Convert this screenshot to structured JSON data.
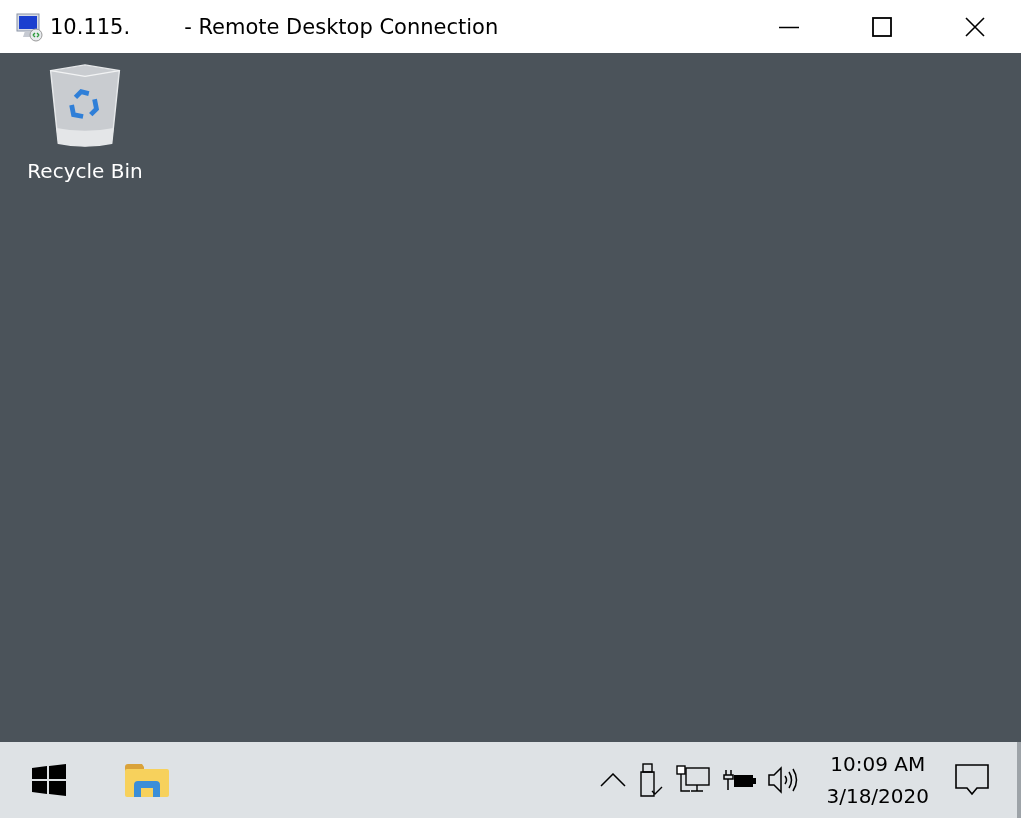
{
  "window": {
    "title_host": "10.115.",
    "title_app": "- Remote Desktop Connection"
  },
  "desktop": {
    "icons": [
      {
        "label": "Recycle Bin"
      }
    ]
  },
  "taskbar": {
    "clock": {
      "time": "10:09 AM",
      "date": "3/18/2020"
    }
  }
}
